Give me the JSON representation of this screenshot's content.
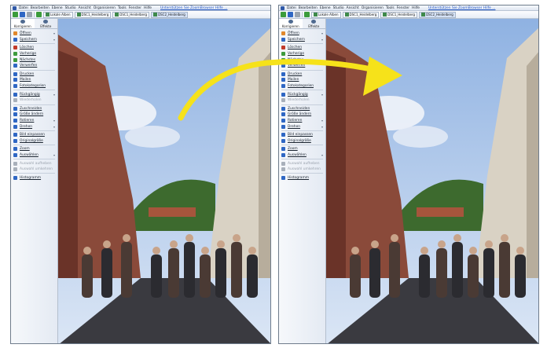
{
  "menu": {
    "items": [
      "Datei",
      "Bearbeiten",
      "Ebene",
      "Studio",
      "Ansicht",
      "Organisieren",
      "Tools",
      "Fenster",
      "Hilfe"
    ],
    "link": "Unterstützen Sie ZoomBrowser Hilfe ..."
  },
  "toolbar": {
    "tabs": [
      "Lokale Alben",
      "DSC1_Heidelberg",
      "DSC1_Heidelberg",
      "DSC2_Heidelberg"
    ]
  },
  "sidebar": {
    "tabs": [
      "Korrigieren",
      "Effekte"
    ],
    "items": [
      {
        "label": "Öffnen",
        "icon": "folder-icon",
        "tone": "orange",
        "chev": true
      },
      {
        "label": "Speichern",
        "icon": "save-icon",
        "tone": "blue",
        "chev": true
      },
      {
        "label": "Löschen",
        "icon": "delete-icon",
        "tone": "red"
      },
      {
        "label": "Vorherige",
        "icon": "previous-icon",
        "tone": "green"
      },
      {
        "label": "Nächstes",
        "icon": "next-icon",
        "tone": "green"
      },
      {
        "label": "Verwerfen",
        "icon": "discard-icon",
        "tone": "blue"
      },
      {
        "label": "Drucken",
        "icon": "print-icon",
        "tone": "blue"
      },
      {
        "label": "Mailen",
        "icon": "mail-icon",
        "tone": "blue"
      },
      {
        "label": "Fotokategorien",
        "icon": "category-icon",
        "tone": "blue"
      },
      {
        "label": "Rückgängig",
        "icon": "undo-icon",
        "tone": "blue",
        "chev": true
      },
      {
        "label": "Wiederholen",
        "icon": "redo-icon",
        "tone": "gray",
        "disabled": true
      },
      {
        "label": "Zuschneiden",
        "icon": "crop-icon",
        "tone": "blue"
      },
      {
        "label": "Größe ändern",
        "icon": "resize-icon",
        "tone": "blue"
      },
      {
        "label": "Rotieren",
        "icon": "rotate-icon",
        "tone": "blue",
        "chev": true
      },
      {
        "label": "Drehen",
        "icon": "flip-icon",
        "tone": "blue",
        "chev": true
      },
      {
        "label": "Bild einpassen",
        "icon": "fit-icon",
        "tone": "blue"
      },
      {
        "label": "Originalgröße",
        "icon": "original-size-icon",
        "tone": "blue"
      },
      {
        "label": "Zoom",
        "icon": "zoom-icon",
        "tone": "blue"
      },
      {
        "label": "Auswählen",
        "icon": "select-icon",
        "tone": "blue",
        "chev": true
      },
      {
        "label": "Auswahl aufheben",
        "icon": "deselect-icon",
        "tone": "gray",
        "disabled": true
      },
      {
        "label": "Auswahl umkehren",
        "icon": "invert-selection-icon",
        "tone": "gray",
        "disabled": true
      },
      {
        "label": "Histogramm",
        "icon": "histogram-icon",
        "tone": "blue"
      }
    ]
  },
  "colors": {
    "sky_top": "#8fb2e2",
    "sky_bottom": "#dbe6f5",
    "arrow": "#f6e21a",
    "building_left": "#8a4a3a",
    "building_right": "#d9d2c4"
  }
}
